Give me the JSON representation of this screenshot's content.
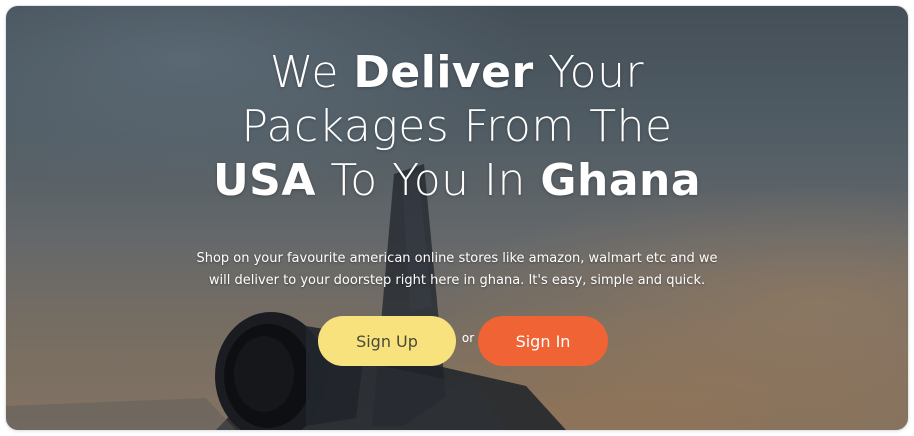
{
  "hero": {
    "headline": {
      "line1_pre": "We ",
      "line1_bold": "Deliver",
      "line1_post": " Your",
      "line2": "Packages From The",
      "line3_bold": "USA",
      "line3_mid": " To You In ",
      "line3_bold2": "Ghana"
    },
    "tagline_line1": "Shop on your favourite american online stores like amazon, walmart etc and we",
    "tagline_line2": "will deliver to your doorstep right here in ghana. It's easy, simple and quick.",
    "signup_label": "Sign Up",
    "or_text": "or",
    "signin_label": "Sign In"
  },
  "colors": {
    "signup_bg": "#f8e27e",
    "signin_bg": "#f06334",
    "text": "#ffffff"
  }
}
